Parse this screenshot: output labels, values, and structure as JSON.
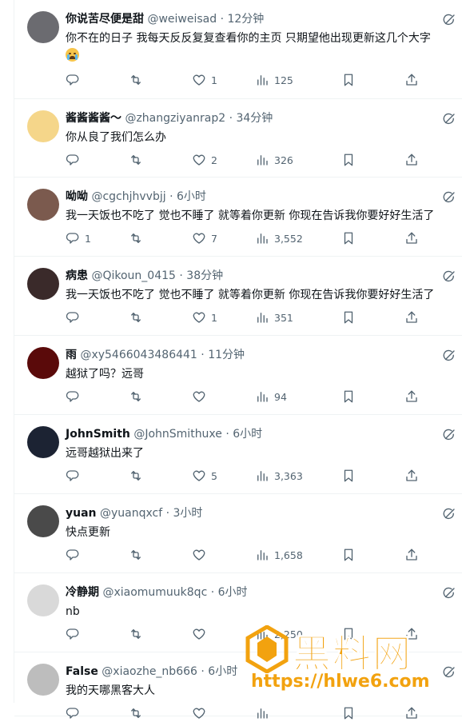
{
  "tweets": [
    {
      "name": "你说苦尽便是甜",
      "handle": "@weiweisad",
      "time": "12分钟",
      "text": "你不在的日子 我每天反反复复查看你的主页 只期望他出现更新这几个大字",
      "replies": "",
      "retweets": "",
      "likes": "1",
      "views": "125",
      "avatar": "#6b6b70",
      "emoji": true
    },
    {
      "name": "酱酱酱酱〜",
      "handle": "@zhangziyanrap2",
      "time": "34分钟",
      "text": "你从良了我们怎么办",
      "replies": "",
      "retweets": "",
      "likes": "2",
      "views": "326",
      "avatar": "#f5d68a",
      "emoji": false
    },
    {
      "name": "呦呦",
      "handle": "@cgchjhvvbjj",
      "time": "6小时",
      "text": "我一天饭也不吃了 觉也不睡了 就等着你更新 你现在告诉我你要好好生活了",
      "replies": "1",
      "retweets": "",
      "likes": "7",
      "views": "3,552",
      "avatar": "#7b5a4e",
      "emoji": false
    },
    {
      "name": "病患",
      "handle": "@Qikoun_0415",
      "time": "38分钟",
      "text": "我一天饭也不吃了 觉也不睡了 就等着你更新 你现在告诉我你要好好生活了",
      "replies": "",
      "retweets": "",
      "likes": "1",
      "views": "351",
      "avatar": "#3a2a2a",
      "emoji": false
    },
    {
      "name": "雨",
      "handle": "@xy5466043486441",
      "time": "11分钟",
      "text": "越狱了吗？远哥",
      "replies": "",
      "retweets": "",
      "likes": "",
      "views": "94",
      "avatar": "#5a0a0a",
      "emoji": false
    },
    {
      "name": "JohnSmith",
      "handle": "@JohnSmithuxe",
      "time": "6小时",
      "text": "远哥越狱出来了",
      "replies": "",
      "retweets": "",
      "likes": "5",
      "views": "3,363",
      "avatar": "#1c2333",
      "emoji": false
    },
    {
      "name": "yuan",
      "handle": "@yuanqxcf",
      "time": "3小时",
      "text": "快点更新",
      "replies": "",
      "retweets": "",
      "likes": "",
      "views": "1,658",
      "avatar": "#4a4a4a",
      "emoji": false
    },
    {
      "name": "冷静期",
      "handle": "@xiaomumuuk8qc",
      "time": "6小时",
      "text": "nb",
      "replies": "",
      "retweets": "",
      "likes": "",
      "views": "2,250",
      "avatar": "#d9d9d9",
      "emoji": false
    },
    {
      "name": "False",
      "handle": "@xiaozhe_nb666",
      "time": "6小时",
      "text": "我的天哪黑客大人",
      "replies": "",
      "retweets": "",
      "likes": "",
      "views": "",
      "avatar": "#bdbdbd",
      "emoji": false
    }
  ],
  "separator": "·",
  "watermark": {
    "title": "黑料网",
    "url": "https://hlwe6.com"
  },
  "colors": {
    "text": "#0f1419",
    "muted": "#536471",
    "border": "#eff3f4",
    "watermark": "#f2a20f"
  }
}
